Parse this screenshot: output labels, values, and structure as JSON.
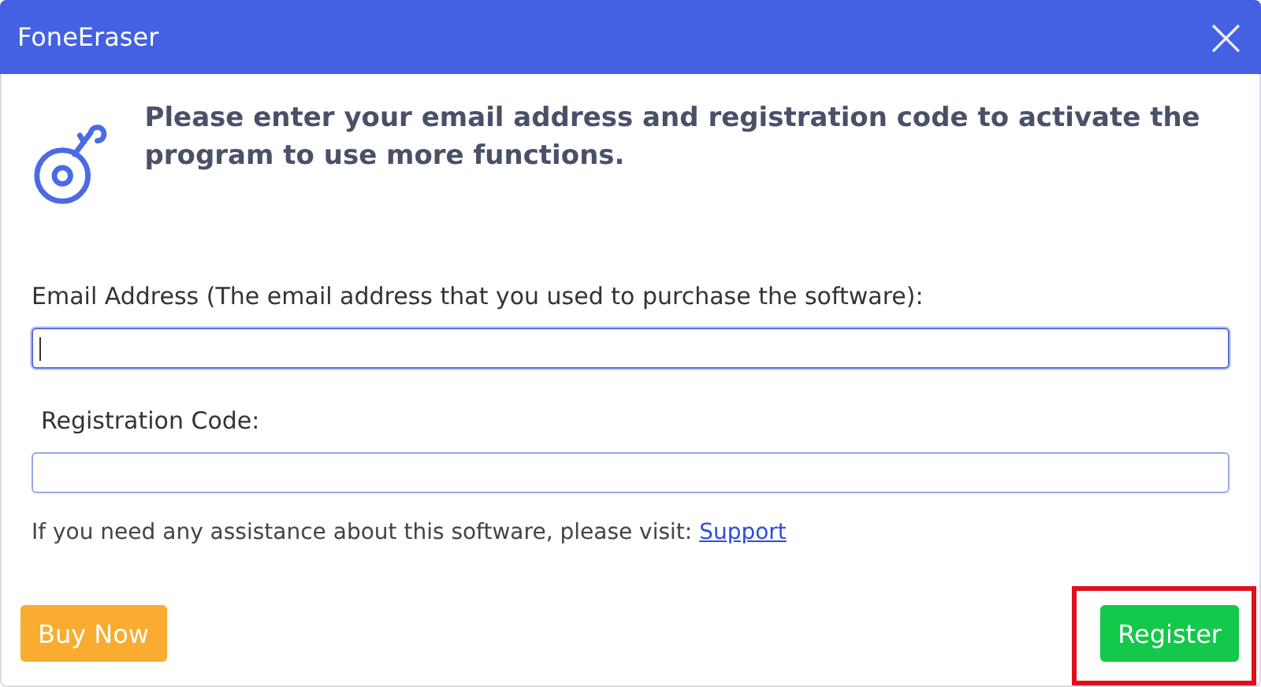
{
  "window": {
    "title": "FoneEraser",
    "close": "×"
  },
  "message": "Please enter your email address and registration code to activate the program to use more functions.",
  "fields": [
    {
      "label": "Email Address (The email address that you used to purchase the software):",
      "focused": true
    },
    {
      "label": "Registration Code:",
      "focused": false
    }
  ],
  "help": {
    "text": "If you need any assistance about this software, please visit:",
    "link": "Support"
  },
  "buttons": [
    {
      "kind": "buy",
      "label": "Buy Now",
      "highlighted": false
    },
    {
      "kind": "register",
      "label": "Register",
      "highlighted": true
    }
  ]
}
